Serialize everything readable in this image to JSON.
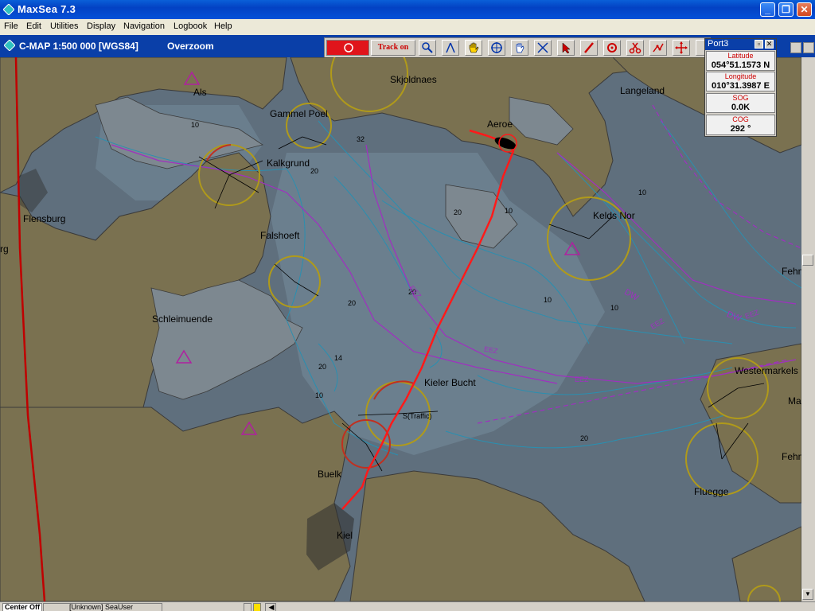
{
  "window": {
    "title": "MaxSea 7.3"
  },
  "menu": [
    "File",
    "Edit",
    "Utilities",
    "Display",
    "Navigation",
    "Logbook",
    "Help"
  ],
  "chart": {
    "title": "C-MAP  1:500 000 [WGS84]",
    "mode": "Overzoom"
  },
  "toolbar": {
    "track_label": "Track on"
  },
  "port": {
    "name": "Port3",
    "latitude_label": "Latitude",
    "latitude": "054°51.1573 N",
    "longitude_label": "Longitude",
    "longitude": "010°31.3987 E",
    "sog_label": "SOG",
    "sog": "0.0K",
    "cog_label": "COG",
    "cog": "292 °"
  },
  "places": {
    "als": "Als",
    "skjoldnaes": "Skjoldnaes",
    "langeland": "Langeland",
    "gammel_poel": "Gammel Poel",
    "aeroe": "Aeroe",
    "kalkgrund": "Kalkgrund",
    "flensburg": "Flensburg",
    "falshoeft": "Falshoeft",
    "kelds_nor": "Kelds Nor",
    "schleimuende": "Schleimuende",
    "fehm1": "Fehm",
    "kieler_bucht": "Kieler Bucht",
    "traffic": "S(Traffic)",
    "westermarkel": "Westermarkels",
    "buelk": "Buelk",
    "kiel": "Kiel",
    "fluegge": "Fluegge",
    "fehm2": "Fehm",
    "rg": "rg",
    "ma": "Ma"
  },
  "depths": {
    "d32": "32",
    "d14": "14",
    "d20": "20",
    "d10a": "10",
    "d20a": "20",
    "d10b": "10",
    "d20b": "20",
    "d20c": "20",
    "d10c": "10",
    "d20d": "20",
    "d20e": "20",
    "d10d": "10",
    "d10e": "10",
    "d10f": "10"
  },
  "zones": {
    "eez1": "EEZ",
    "eez2": "EEZ",
    "eez3": "EEZ",
    "eez4": "EEZ",
    "eez5": "EEZ",
    "dw1": "DW",
    "dw2": "DW"
  },
  "status": {
    "center": "Center Off",
    "user": "[Unknown]  SeaUser"
  },
  "colors": {
    "land": "#7a7150",
    "water": "#5f6f7d",
    "shallow": "#6c8090",
    "track": "#ff1a1a",
    "title_blue": "#0a3fa8"
  }
}
